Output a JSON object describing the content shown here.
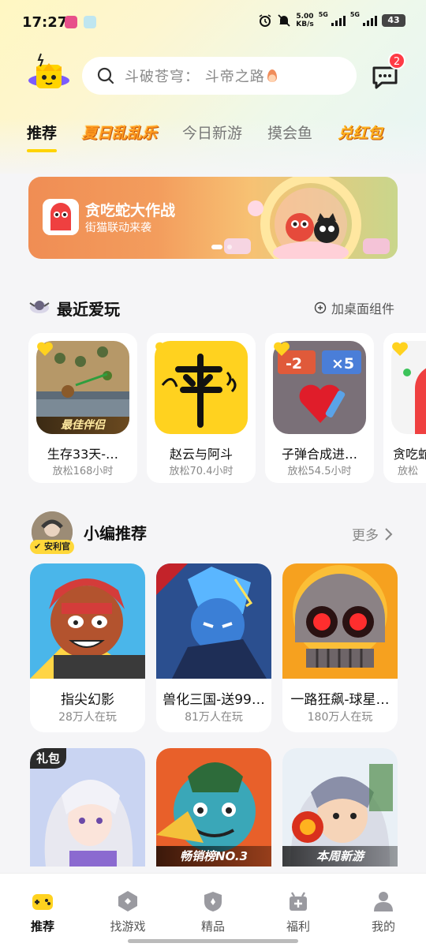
{
  "status_bar": {
    "time": "17:27",
    "net_speed_value": "5.00",
    "net_speed_unit": "KB/s",
    "sim1": "5G",
    "sim2": "5G",
    "battery": "43"
  },
  "header": {
    "search_placeholder": "斗破苍穹： 斗帝之路",
    "message_badge": "2"
  },
  "tabs": [
    {
      "label": "推荐",
      "active": true
    },
    {
      "label": "夏日乱乱乐"
    },
    {
      "label": "今日新游"
    },
    {
      "label": "摸会鱼"
    },
    {
      "label": "兑红包"
    }
  ],
  "banner": {
    "title": "贪吃蛇大作战",
    "subtitle": "街猫联动来袭"
  },
  "recent": {
    "title": "最近爱玩",
    "action": "加桌面组件",
    "items": [
      {
        "name": "生存33天-…",
        "time": "放松168小时",
        "ribbon": "最佳伴侣"
      },
      {
        "name": "赵云与阿斗",
        "time": "放松70.4小时"
      },
      {
        "name": "子弹合成进…",
        "time": "放松54.5小时",
        "chip_left": "-2",
        "chip_right": "×5"
      },
      {
        "name": "贪吃蛇",
        "time": "放松"
      }
    ]
  },
  "editor": {
    "title": "小编推荐",
    "more": "更多",
    "official_badge": "安利官",
    "games": [
      {
        "name": "指尖幻影",
        "players": "28万人在玩"
      },
      {
        "name": "兽化三国-送99…",
        "players": "81万人在玩"
      },
      {
        "name": "一路狂飙-球星…",
        "players": "180万人在玩"
      }
    ],
    "games_row2": [
      {
        "tag": "礼包"
      },
      {
        "tag": "畅销榜NO.3"
      },
      {
        "tag": "本周新游"
      }
    ]
  },
  "bottom_nav": [
    {
      "label": "推荐",
      "icon": "gamepad-icon",
      "active": true
    },
    {
      "label": "找游戏",
      "icon": "hexagon-icon"
    },
    {
      "label": "精品",
      "icon": "shield-icon"
    },
    {
      "label": "福利",
      "icon": "gift-icon"
    },
    {
      "label": "我的",
      "icon": "user-icon"
    }
  ]
}
